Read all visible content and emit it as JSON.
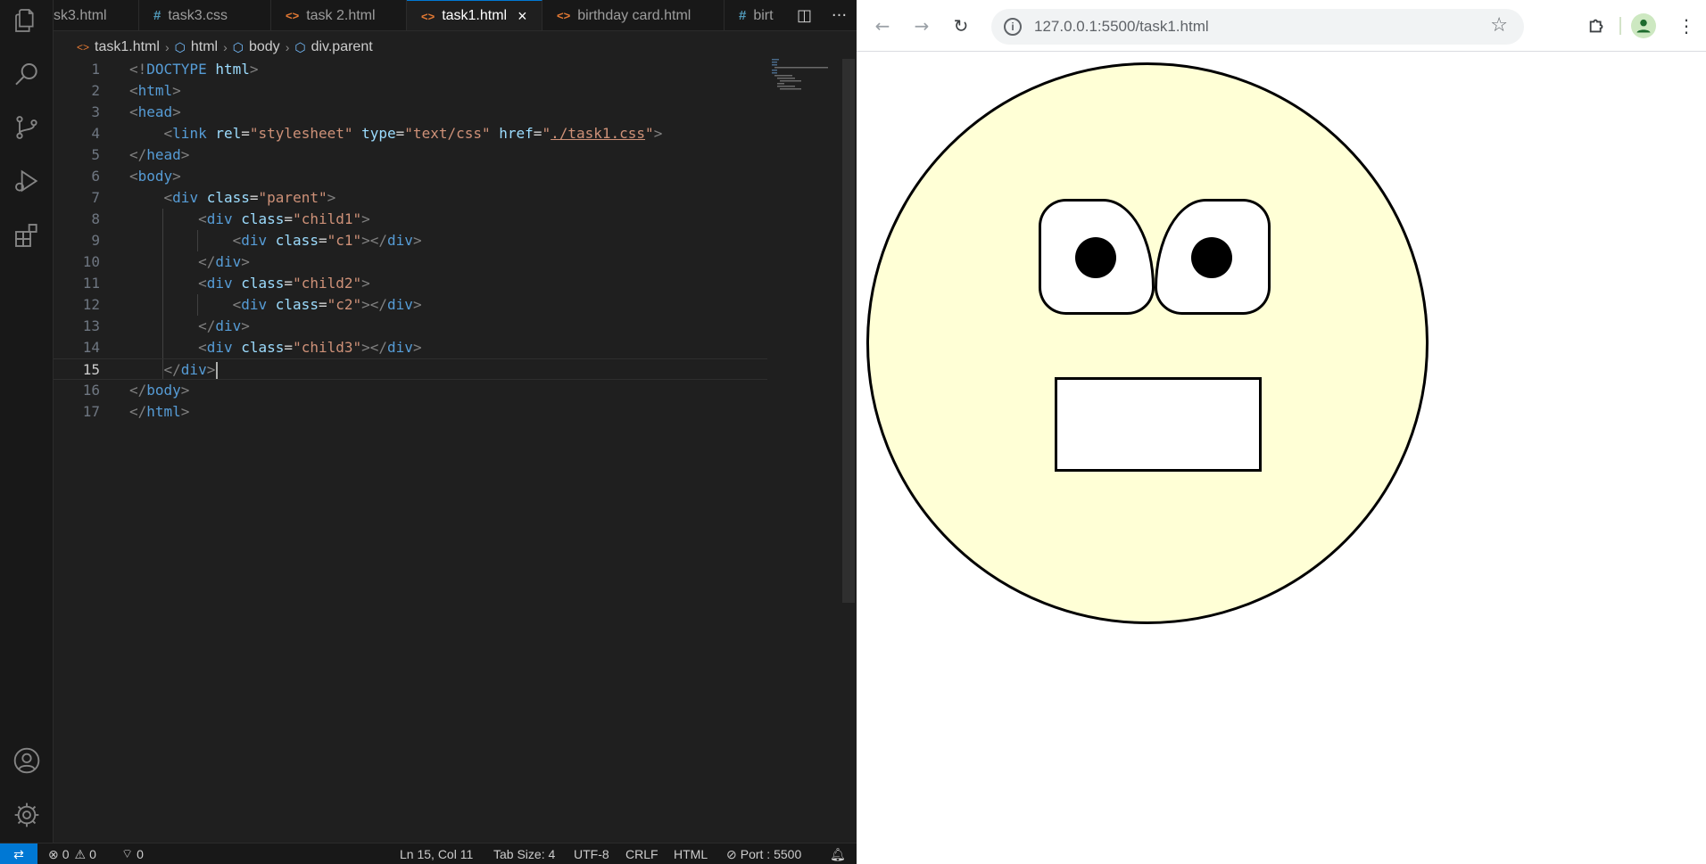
{
  "editor": {
    "tabs": [
      {
        "label": "sk3.html",
        "icon": "html-file-icon",
        "active": false
      },
      {
        "label": "task3.css",
        "icon": "css-file-icon",
        "active": false
      },
      {
        "label": "task 2.html",
        "icon": "html-file-icon",
        "active": false
      },
      {
        "label": "task1.html",
        "icon": "html-file-icon",
        "active": true
      },
      {
        "label": "birthday card.html",
        "icon": "html-file-icon",
        "active": false
      },
      {
        "label": "birt",
        "icon": "css-file-icon",
        "active": false
      }
    ],
    "icons": {
      "html": "<>",
      "css": "#",
      "close": "×",
      "split": "◫",
      "more": "···"
    },
    "breadcrumb": [
      "task1.html",
      "html",
      "body",
      "div.parent"
    ],
    "lines": [
      {
        "n": "1",
        "tokens": [
          [
            "punc",
            "<!"
          ],
          [
            "tag",
            "DOCTYPE"
          ],
          [
            "plain",
            " "
          ],
          [
            "attr",
            "html"
          ],
          [
            "punc",
            ">"
          ]
        ]
      },
      {
        "n": "2",
        "tokens": [
          [
            "punc",
            "<"
          ],
          [
            "tag",
            "html"
          ],
          [
            "punc",
            ">"
          ]
        ]
      },
      {
        "n": "3",
        "tokens": [
          [
            "punc",
            "<"
          ],
          [
            "tag",
            "head"
          ],
          [
            "punc",
            ">"
          ]
        ]
      },
      {
        "n": "4",
        "tokens": [
          [
            "plain",
            "    "
          ],
          [
            "punc",
            "<"
          ],
          [
            "tag",
            "link"
          ],
          [
            "plain",
            " "
          ],
          [
            "attr",
            "rel"
          ],
          [
            "plain",
            "="
          ],
          [
            "str",
            "\"stylesheet\""
          ],
          [
            "plain",
            " "
          ],
          [
            "attr",
            "type"
          ],
          [
            "plain",
            "="
          ],
          [
            "str",
            "\"text/css\""
          ],
          [
            "plain",
            " "
          ],
          [
            "attr",
            "href"
          ],
          [
            "plain",
            "="
          ],
          [
            "str",
            "\""
          ],
          [
            "link",
            "./task1.css"
          ],
          [
            "str",
            "\""
          ],
          [
            "punc",
            ">"
          ]
        ]
      },
      {
        "n": "5",
        "tokens": [
          [
            "punc",
            "</"
          ],
          [
            "tag",
            "head"
          ],
          [
            "punc",
            ">"
          ]
        ]
      },
      {
        "n": "6",
        "tokens": [
          [
            "punc",
            "<"
          ],
          [
            "tag",
            "body"
          ],
          [
            "punc",
            ">"
          ]
        ]
      },
      {
        "n": "7",
        "tokens": [
          [
            "plain",
            "    "
          ],
          [
            "punc",
            "<"
          ],
          [
            "tag",
            "div"
          ],
          [
            "plain",
            " "
          ],
          [
            "attr",
            "class"
          ],
          [
            "plain",
            "="
          ],
          [
            "str",
            "\"parent\""
          ],
          [
            "punc",
            ">"
          ]
        ]
      },
      {
        "n": "8",
        "tokens": [
          [
            "plain",
            "        "
          ],
          [
            "punc",
            "<"
          ],
          [
            "tag",
            "div"
          ],
          [
            "plain",
            " "
          ],
          [
            "attr",
            "class"
          ],
          [
            "plain",
            "="
          ],
          [
            "str",
            "\"child1\""
          ],
          [
            "punc",
            ">"
          ]
        ]
      },
      {
        "n": "9",
        "tokens": [
          [
            "plain",
            "            "
          ],
          [
            "punc",
            "<"
          ],
          [
            "tag",
            "div"
          ],
          [
            "plain",
            " "
          ],
          [
            "attr",
            "class"
          ],
          [
            "plain",
            "="
          ],
          [
            "str",
            "\"c1\""
          ],
          [
            "punc",
            "></"
          ],
          [
            "tag",
            "div"
          ],
          [
            "punc",
            ">"
          ]
        ]
      },
      {
        "n": "10",
        "tokens": [
          [
            "plain",
            "        "
          ],
          [
            "punc",
            "</"
          ],
          [
            "tag",
            "div"
          ],
          [
            "punc",
            ">"
          ]
        ]
      },
      {
        "n": "11",
        "tokens": [
          [
            "plain",
            "        "
          ],
          [
            "punc",
            "<"
          ],
          [
            "tag",
            "div"
          ],
          [
            "plain",
            " "
          ],
          [
            "attr",
            "class"
          ],
          [
            "plain",
            "="
          ],
          [
            "str",
            "\"child2\""
          ],
          [
            "punc",
            ">"
          ]
        ]
      },
      {
        "n": "12",
        "tokens": [
          [
            "plain",
            "            "
          ],
          [
            "punc",
            "<"
          ],
          [
            "tag",
            "div"
          ],
          [
            "plain",
            " "
          ],
          [
            "attr",
            "class"
          ],
          [
            "plain",
            "="
          ],
          [
            "str",
            "\"c2\""
          ],
          [
            "punc",
            "></"
          ],
          [
            "tag",
            "div"
          ],
          [
            "punc",
            ">"
          ]
        ]
      },
      {
        "n": "13",
        "tokens": [
          [
            "plain",
            "        "
          ],
          [
            "punc",
            "</"
          ],
          [
            "tag",
            "div"
          ],
          [
            "punc",
            ">"
          ]
        ]
      },
      {
        "n": "14",
        "tokens": [
          [
            "plain",
            "        "
          ],
          [
            "punc",
            "<"
          ],
          [
            "tag",
            "div"
          ],
          [
            "plain",
            " "
          ],
          [
            "attr",
            "class"
          ],
          [
            "plain",
            "="
          ],
          [
            "str",
            "\"child3\""
          ],
          [
            "punc",
            "></"
          ],
          [
            "tag",
            "div"
          ],
          [
            "punc",
            ">"
          ]
        ]
      },
      {
        "n": "15",
        "tokens": [
          [
            "plain",
            "    "
          ],
          [
            "punc",
            "</"
          ],
          [
            "tag",
            "div"
          ],
          [
            "punc",
            ">"
          ]
        ],
        "current": true
      },
      {
        "n": "16",
        "tokens": [
          [
            "punc",
            "</"
          ],
          [
            "tag",
            "body"
          ],
          [
            "punc",
            ">"
          ]
        ]
      },
      {
        "n": "17",
        "tokens": [
          [
            "punc",
            "</"
          ],
          [
            "tag",
            "html"
          ],
          [
            "punc",
            ">"
          ]
        ]
      }
    ],
    "status": {
      "errors": "0",
      "warnings": "0",
      "ports": "0",
      "position": "Ln 15, Col 11",
      "tab_size": "Tab Size: 4",
      "encoding": "UTF-8",
      "eol": "CRLF",
      "language": "HTML",
      "port": "Port : 5500"
    }
  },
  "browser": {
    "url": "127.0.0.1:5500/task1.html",
    "info_glyph": "i",
    "back_glyph": "←",
    "forward_glyph": "→",
    "reload_glyph": "↻",
    "star_glyph": "☆",
    "menu_glyph": "⋮"
  },
  "colors": {
    "accent": "#0078d4",
    "face_fill": "#ffffd6",
    "editor_bg": "#1f1f1f"
  }
}
